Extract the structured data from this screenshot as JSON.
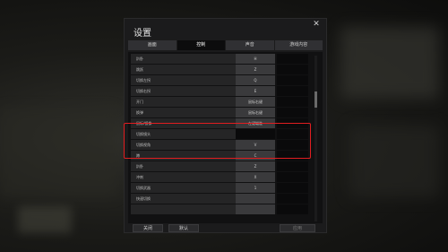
{
  "dialog": {
    "title": "设置",
    "close_glyph": "✕",
    "tabs": [
      {
        "label": "画面",
        "active": false
      },
      {
        "label": "控制",
        "active": true
      },
      {
        "label": "声音",
        "active": false
      },
      {
        "label": "游戏内容",
        "active": false
      }
    ],
    "rows": [
      {
        "label": "趴卧",
        "value": "H"
      },
      {
        "label": "跳跃",
        "value": "Z"
      },
      {
        "label": "切换左拐",
        "value": "Q"
      },
      {
        "label": "切换右拐",
        "value": "E"
      },
      {
        "label": "开门",
        "value": "鼠标右键"
      },
      {
        "label": "换弹",
        "value": "鼠标右键"
      },
      {
        "label": "鼠标/镜像",
        "value": "左键瞄准",
        "highlight": true
      },
      {
        "label": "切换镜头",
        "value": "",
        "highlight": true
      },
      {
        "label": "切换视角",
        "value": "V",
        "highlight": true
      },
      {
        "label": "蹲",
        "value": "C"
      },
      {
        "label": "趴卧",
        "value": "Z"
      },
      {
        "label": "冲刺",
        "value": "X"
      },
      {
        "label": "切换武器",
        "value": "1"
      },
      {
        "label": "快速切换",
        "value": ""
      },
      {
        "label": "",
        "value": ""
      }
    ],
    "footer": {
      "close_label": "关闭",
      "reset_label": "默认",
      "apply_label": "应用"
    }
  },
  "colors": {
    "highlight_border": "#e01d20",
    "active_tab": "#0c0c0d"
  }
}
